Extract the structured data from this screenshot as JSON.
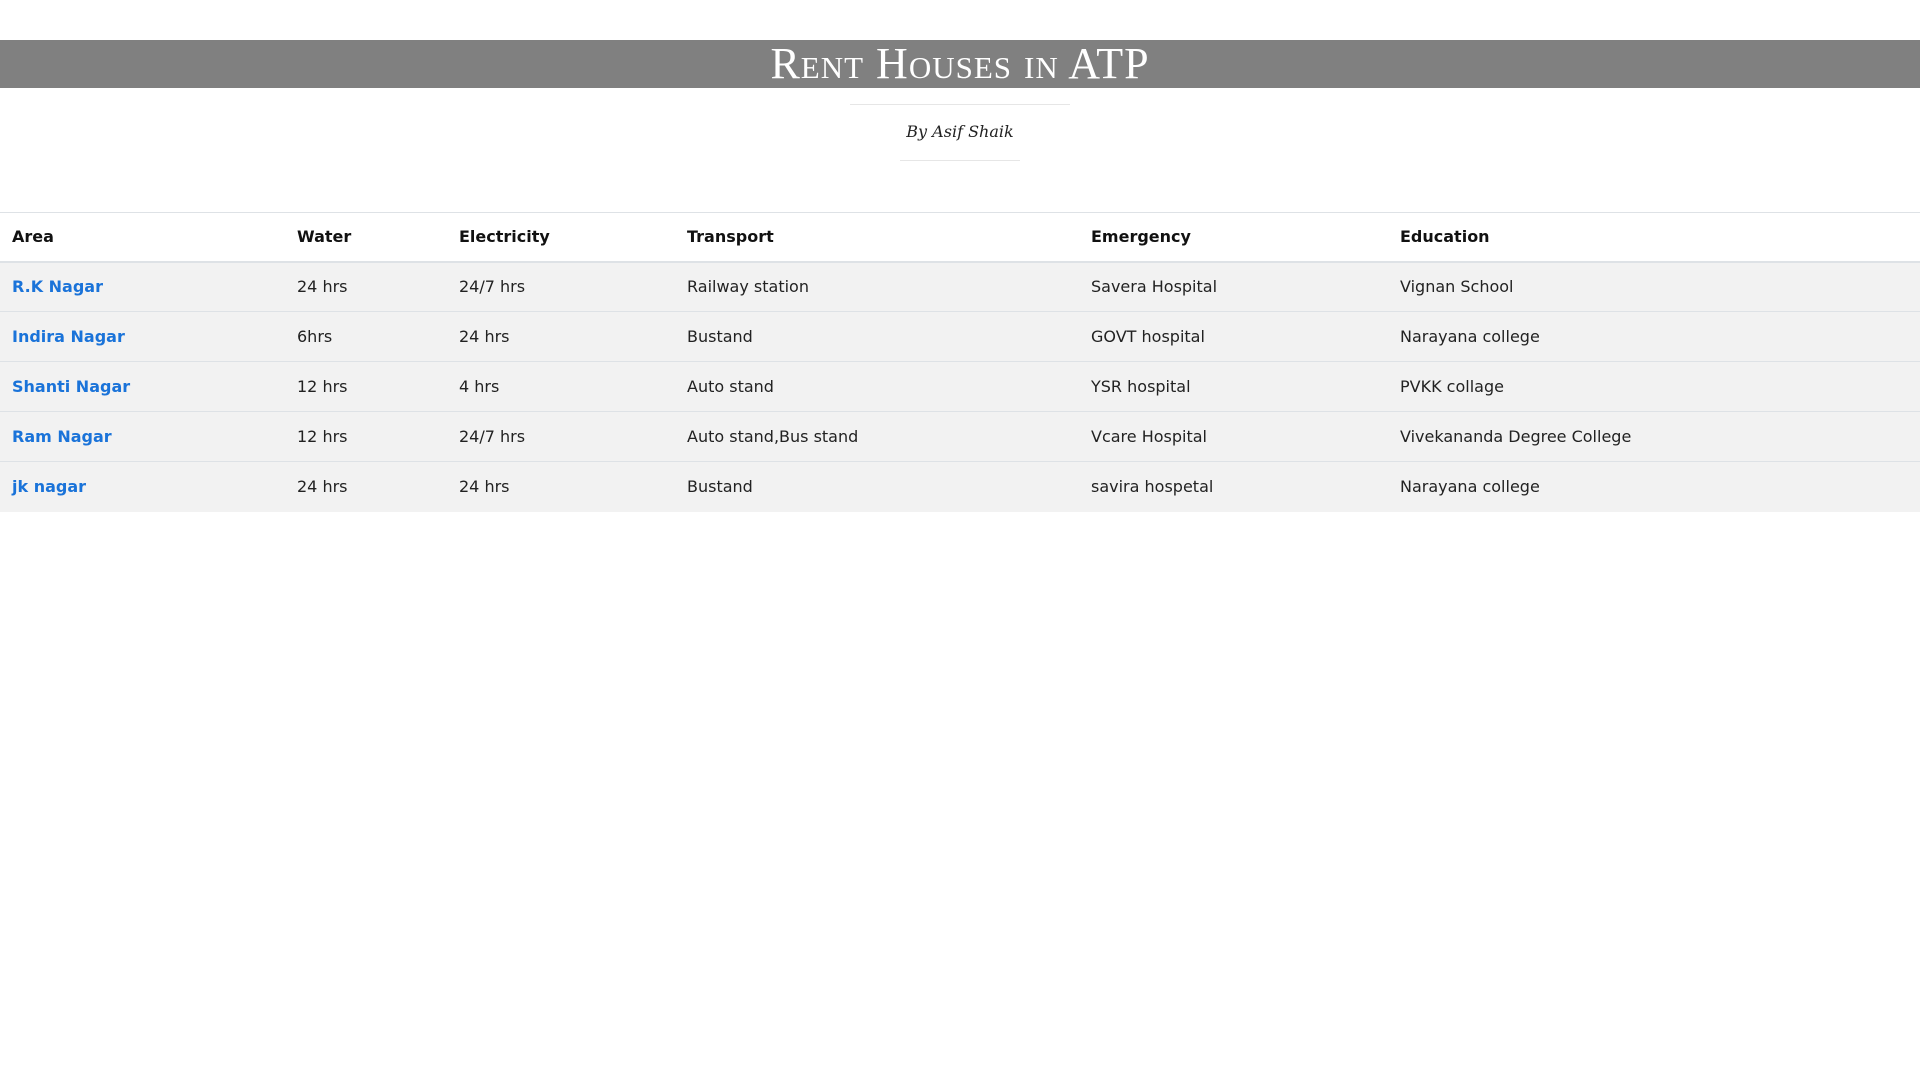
{
  "header": {
    "title": "Rent Houses in ATP",
    "byline": "By Asif Shaik"
  },
  "colors": {
    "banner_bg": "#808080",
    "banner_text": "#ffffff",
    "row_bg": "#f2f2f2",
    "link": "#1a73d9"
  },
  "table": {
    "columns": [
      "Area",
      "Water",
      "Electricity",
      "Transport",
      "Emergency",
      "Education"
    ],
    "rows": [
      {
        "area": "R.K Nagar",
        "water": "24 hrs",
        "electricity": "24/7 hrs",
        "transport": "Railway station",
        "emergency": "Savera Hospital",
        "education": "Vignan School"
      },
      {
        "area": "Indira Nagar",
        "water": "6hrs",
        "electricity": "24 hrs",
        "transport": "Bustand",
        "emergency": "GOVT hospital",
        "education": "Narayana college"
      },
      {
        "area": "Shanti Nagar",
        "water": "12 hrs",
        "electricity": "4 hrs",
        "transport": "Auto stand",
        "emergency": "YSR hospital",
        "education": "PVKK collage"
      },
      {
        "area": "Ram Nagar",
        "water": "12 hrs",
        "electricity": "24/7 hrs",
        "transport": "Auto stand,Bus stand",
        "emergency": "Vcare Hospital",
        "education": "Vivekananda Degree College"
      },
      {
        "area": "jk nagar",
        "water": "24 hrs",
        "electricity": "24 hrs",
        "transport": "Bustand",
        "emergency": "savira hospetal",
        "education": "Narayana college"
      }
    ]
  }
}
